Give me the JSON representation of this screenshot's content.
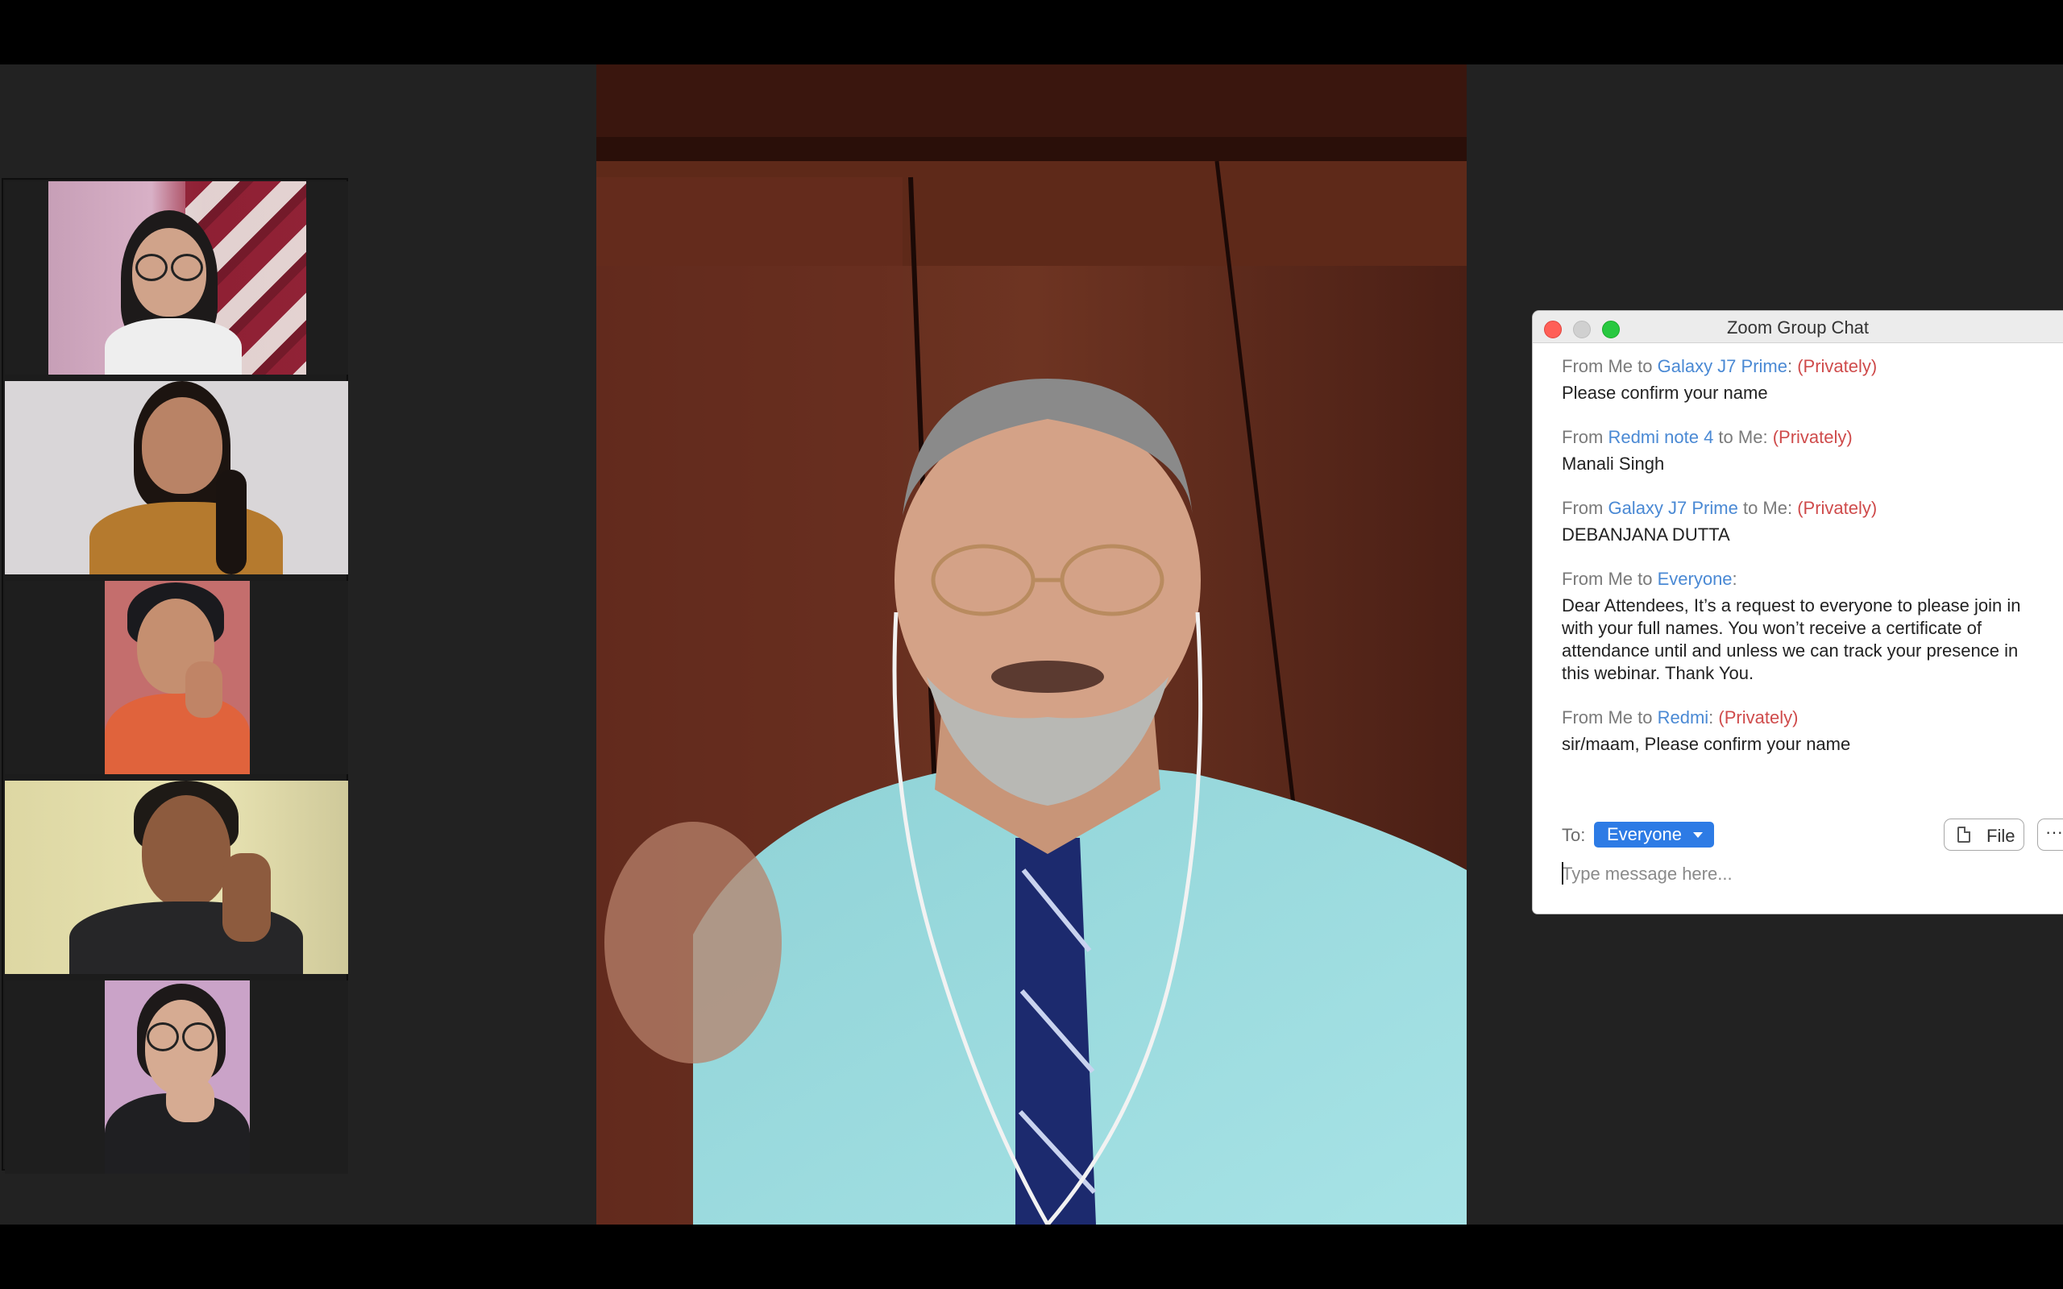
{
  "app": {
    "chat_window_title": "Zoom Group Chat"
  },
  "participants": [
    {
      "id": "participant-1"
    },
    {
      "id": "participant-2"
    },
    {
      "id": "participant-3"
    },
    {
      "id": "participant-4"
    },
    {
      "id": "participant-5"
    }
  ],
  "chat": {
    "messages": [
      {
        "prefix": "From ",
        "from": "Me",
        "mid": " to ",
        "to": "Galaxy J7 Prime",
        "colon": ": ",
        "private": "(Privately)",
        "text": "Please confirm your name"
      },
      {
        "prefix": "From ",
        "from": "Redmi note 4",
        "mid": " to ",
        "to": "Me",
        "colon": ": ",
        "private": "(Privately)",
        "text": "Manali Singh"
      },
      {
        "prefix": "From ",
        "from": "Galaxy J7 Prime",
        "mid": " to ",
        "to": "Me",
        "colon": ": ",
        "private": "(Privately)",
        "text": "DEBANJANA DUTTA"
      },
      {
        "prefix": "From ",
        "from": "Me",
        "mid": " to ",
        "to": "Everyone",
        "colon": ":",
        "private": "",
        "text": "Dear Attendees, It’s a request to everyone to please join in with your full names. You won’t receive a certificate of attendance until and unless we can track your presence in this webinar. Thank You."
      },
      {
        "prefix": "From ",
        "from": "Me",
        "mid": " to ",
        "to": "Redmi",
        "colon": ": ",
        "private": "(Privately)",
        "text": "sir/maam, Please confirm your name"
      }
    ],
    "to_label": "To:",
    "to_value": "Everyone",
    "file_button": "File",
    "more_button": "···",
    "input_placeholder": "Type message here..."
  },
  "colors": {
    "participant_name_link": "#4a89d4",
    "private_tag": "#cf4b4b",
    "to_pill": "#2d7be5",
    "close_light": "#ff5f57",
    "maximize_light": "#28c840"
  },
  "icons": [
    "close-icon",
    "minimize-icon",
    "maximize-icon",
    "file-icon",
    "more-icon",
    "dropdown-caret-icon"
  ]
}
